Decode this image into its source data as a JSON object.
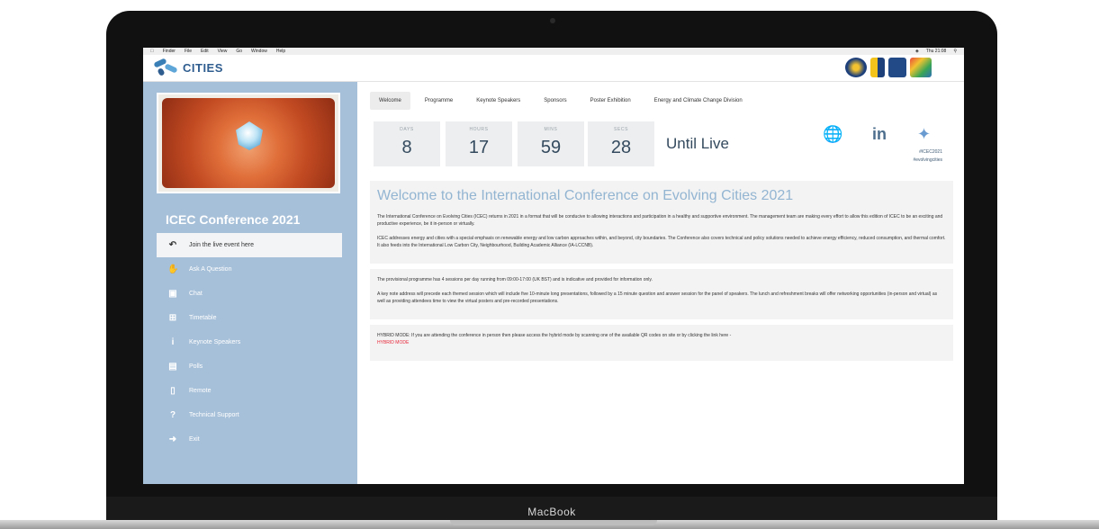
{
  "device": {
    "brand": "MacBook"
  },
  "menubar": {
    "items": [
      "Finder",
      "File",
      "Edit",
      "View",
      "Go",
      "Window",
      "Help"
    ],
    "clock": "Thu 21:08"
  },
  "header": {
    "logo_text": "CITIES"
  },
  "sidebar": {
    "title": "ICEC Conference 2021",
    "items": [
      {
        "label": "Join the live event here",
        "icon": "reply-icon",
        "active": true
      },
      {
        "label": "Ask A Question",
        "icon": "hand-icon"
      },
      {
        "label": "Chat",
        "icon": "chat-icon"
      },
      {
        "label": "Timetable",
        "icon": "table-icon"
      },
      {
        "label": "Keynote Speakers",
        "icon": "info-icon"
      },
      {
        "label": "Polls",
        "icon": "poll-icon"
      },
      {
        "label": "Remote",
        "icon": "remote-icon"
      },
      {
        "label": "Technical Support",
        "icon": "question-icon"
      },
      {
        "label": "Exit",
        "icon": "exit-icon"
      }
    ]
  },
  "tabs": [
    "Welcome",
    "Programme",
    "Keynote Speakers",
    "Sponsors",
    "Poster Exhibition",
    "Energy and Climate Change Division"
  ],
  "countdown": {
    "days_label": "DAYS",
    "days": "8",
    "hours_label": "HOURS",
    "hours": "17",
    "mins_label": "MINS",
    "mins": "59",
    "secs_label": "SECS",
    "secs": "28",
    "until": "Until Live"
  },
  "social": {
    "hashtag1": "#ICEC2021",
    "hashtag2": "#evolvingcities"
  },
  "welcome": {
    "title": "Welcome to the International Conference on Evolving Cities 2021",
    "p1": "The International Conference on Evolving Cities (ICEC) returns in 2021 in a format that will be conducive to allowing interactions and participation in a healthy and supportive environment. The management team are making every effort to allow this edition of ICEC to be an exciting and productive experience, be it in-person or virtually.",
    "p2": "ICEC addresses energy and cities with a special emphasis on renewable energy and low carbon approaches within, and beyond, city boundaries. The Conference also covers technical and policy solutions needed to achieve energy efficiency, reduced consumption, and thermal comfort. It also feeds into the International Low Carbon City, Neighbourhood, Building Academic Alliance (IA-LCCNB)."
  },
  "programme": {
    "p1": "The provisional programme has 4 sessions per day running from 09:00-17:00 (UK BST) and is indicative and provided for information only.",
    "p2": "A key note address will precede each themed session which will include five 10-minute long presentations, followed by a 15 minute question and answer session for the panel of speakers. The lunch and refreshment breaks will offer networking opportunities (in-person and virtual) as well as providing attendees time to view the virtual posters and pre-recorded presentations."
  },
  "hybrid": {
    "text": "HYBRID MODE: If you are attending the conference in person then please access the hybrid mode by scanning one of the available QR codes on site or by clicking the link here -",
    "link": "HYBRID MODE",
    "link_color": "#e8283a"
  }
}
